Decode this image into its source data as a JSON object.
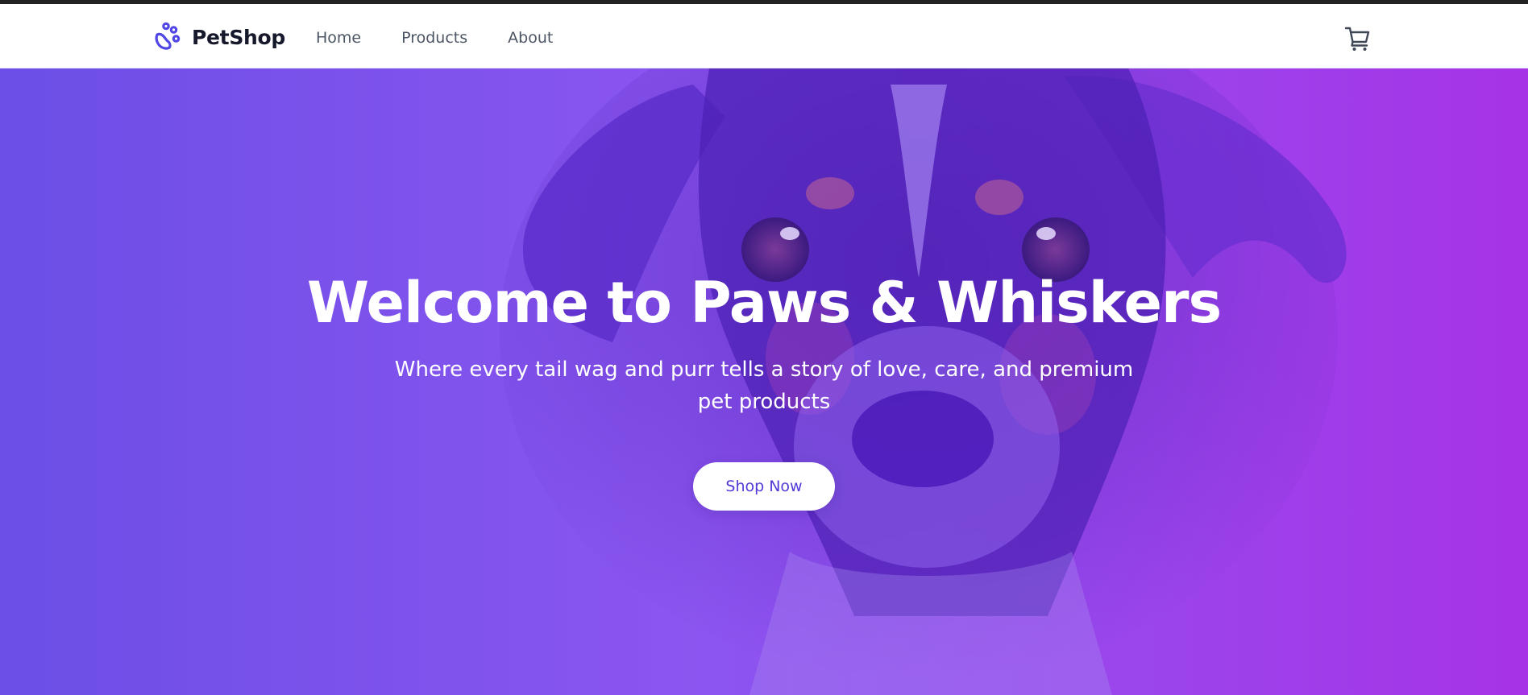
{
  "brand": {
    "name": "PetShop",
    "icon": "paw-icon",
    "icon_color": "#4f46e5"
  },
  "nav": {
    "links": [
      {
        "label": "Home"
      },
      {
        "label": "Products"
      },
      {
        "label": "About"
      }
    ],
    "cart_icon": "shopping-cart-icon"
  },
  "hero": {
    "title": "Welcome to Paws & Whiskers",
    "subtitle": "Where every tail wag and purr tells a story of love, care, and premium pet products",
    "cta_label": "Shop Now",
    "background_image": "dog-photo",
    "gradient_colors": [
      "#6b4fe6",
      "#8b55f0",
      "#a633e6"
    ]
  },
  "colors": {
    "accent": "#4f46e5",
    "text_dark": "#15192b",
    "nav_text": "#4b5563",
    "cta_text": "#4f3ad8"
  }
}
